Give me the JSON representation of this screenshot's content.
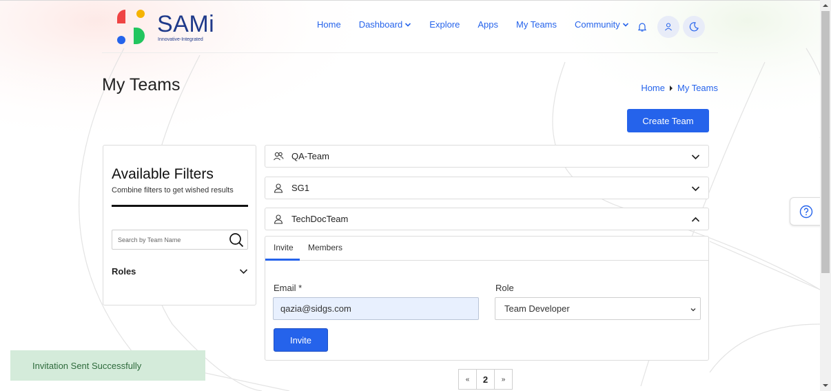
{
  "brand": {
    "name": "SAMi",
    "tagline": "Innovative-Integrated",
    "accent": "#2563eb"
  },
  "nav": {
    "items": [
      {
        "label": "Home"
      },
      {
        "label": "Dashboard"
      },
      {
        "label": "Explore"
      },
      {
        "label": "Apps"
      },
      {
        "label": "My Teams"
      },
      {
        "label": "Community"
      }
    ],
    "icons": [
      "bell-icon",
      "user-icon",
      "moon-icon"
    ]
  },
  "page": {
    "title": "My Teams",
    "breadcrumb": [
      "Home",
      "My Teams"
    ],
    "create_button": "Create Team"
  },
  "filters": {
    "title": "Available Filters",
    "subtitle": "Combine filters to get wished results",
    "search_placeholder": "Search by Team Name",
    "roles_label": "Roles"
  },
  "teams": [
    {
      "name": "QA-Team",
      "icon": "users-icon",
      "expanded": false
    },
    {
      "name": "SG1",
      "icon": "user-icon",
      "expanded": false
    },
    {
      "name": "TechDocTeam",
      "icon": "user-icon",
      "expanded": true
    }
  ],
  "invite_panel": {
    "tabs": [
      "Invite",
      "Members"
    ],
    "active_tab": "Invite",
    "email_label": "Email *",
    "email_value": "qazia@sidgs.com",
    "role_label": "Role",
    "role_value": "Team Developer",
    "invite_button": "Invite"
  },
  "pagination": {
    "prev": "«",
    "current": "2",
    "next": "»"
  },
  "toast": {
    "message": "Invitation Sent Successfully",
    "color": "#d4ebda"
  }
}
